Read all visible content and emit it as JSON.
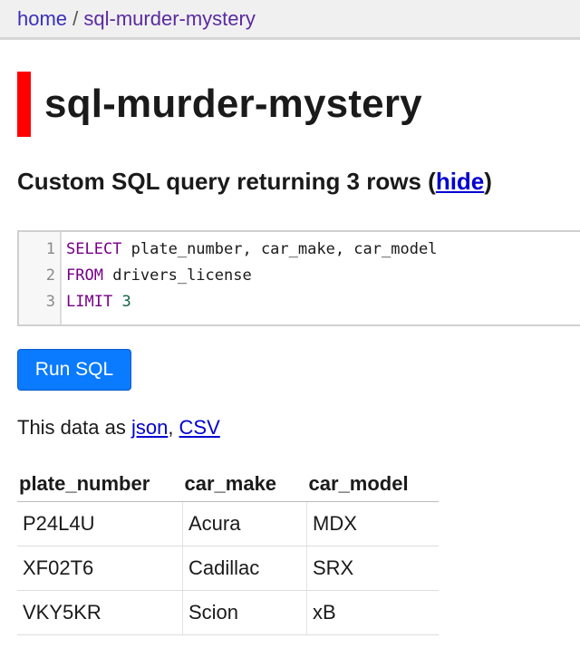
{
  "breadcrumb": {
    "home": "home",
    "separator": " / ",
    "current": "sql-murder-mystery"
  },
  "database": {
    "title": "sql-murder-mystery",
    "accent_color": "#ff0000"
  },
  "query_heading": {
    "text": "Custom SQL query returning 3 rows (",
    "hide_link": "hide",
    "close": ")"
  },
  "editor": {
    "lines": [
      {
        "number": "1",
        "keyword": "SELECT",
        "rest": " plate_number, car_make, car_model"
      },
      {
        "number": "2",
        "keyword": "FROM",
        "rest": " drivers_license"
      },
      {
        "number": "3",
        "keyword": "LIMIT",
        "rest": " ",
        "num": "3"
      }
    ]
  },
  "run_button": {
    "label": "Run SQL",
    "color": "#0a7aff"
  },
  "export": {
    "prefix": "This data as ",
    "json": "json",
    "sep": ", ",
    "csv": "CSV"
  },
  "table": {
    "headers": [
      "plate_number",
      "car_make",
      "car_model"
    ],
    "rows": [
      [
        "P24L4U",
        "Acura",
        "MDX"
      ],
      [
        "XF02T6",
        "Cadillac",
        "SRX"
      ],
      [
        "VKY5KR",
        "Scion",
        "xB"
      ]
    ]
  }
}
